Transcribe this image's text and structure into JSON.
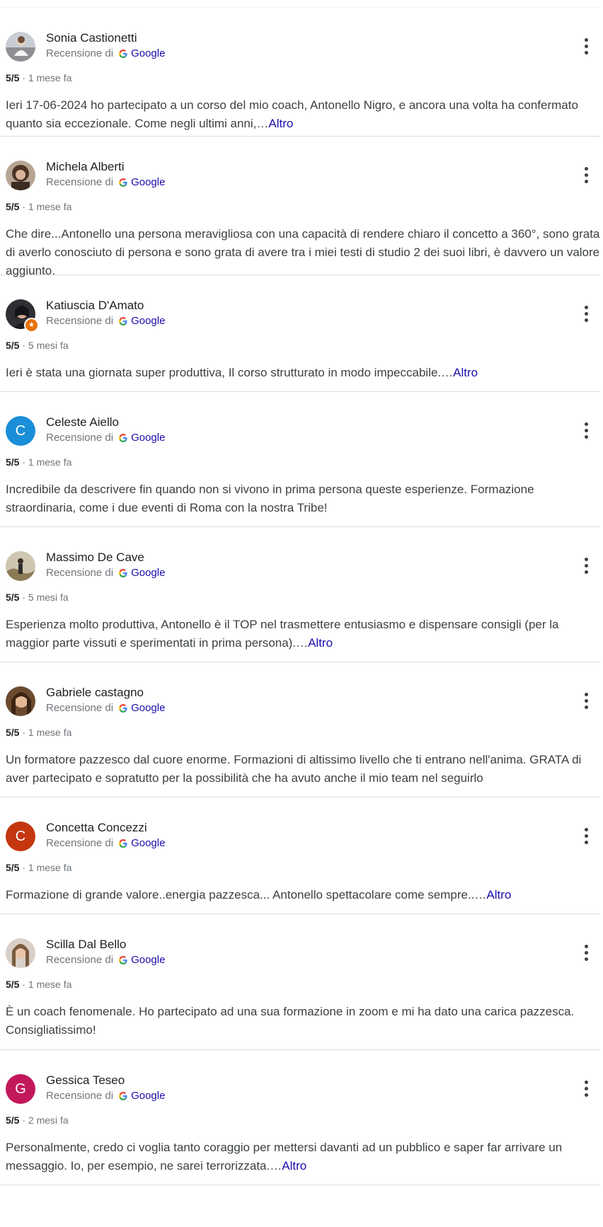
{
  "reviews": [
    {
      "name": "Sonia Castionetti",
      "source_prefix": "Recensione di",
      "source": "Google",
      "rating": "5/5",
      "time": "1 mese fa",
      "text": "Ieri 17-06-2024 ho partecipato a un corso del mio coach, Antonello Nigro, e ancora una volta ha confermato quanto sia eccezionale. Come negli ultimi anni,…",
      "more": "Altro"
    },
    {
      "name": "Michela Alberti",
      "source_prefix": "Recensione di",
      "source": "Google",
      "rating": "5/5",
      "time": "1 mese fa",
      "text": "Che dire...Antonello una persona meravigliosa con una capacità di rendere chiaro il concetto a 360°, sono grata di averlo conosciuto di persona e sono grata di avere tra i miei testi di studio 2 dei suoi libri, è davvero un valore aggiunto.",
      "more": ""
    },
    {
      "name": "Katiuscia D'Amato",
      "source_prefix": "Recensione di",
      "source": "Google",
      "rating": "5/5",
      "time": "5 mesi fa",
      "text": "Ieri è stata una giornata super produttiva, Il corso strutturato in modo impeccabile.…",
      "more": "Altro"
    },
    {
      "name": "Celeste Aiello",
      "source_prefix": "Recensione di",
      "source": "Google",
      "rating": "5/5",
      "time": "1 mese fa",
      "text": "Incredibile da descrivere fin quando non si vivono in prima persona queste esperienze. Formazione straordinaria, come i due eventi di Roma con la nostra Tribe!",
      "more": ""
    },
    {
      "name": "Massimo De Cave",
      "source_prefix": "Recensione di",
      "source": "Google",
      "rating": "5/5",
      "time": "5 mesi fa",
      "text": "Esperienza molto produttiva, Antonello è il TOP nel trasmettere entusiasmo e dispensare consigli (per la maggior parte vissuti e sperimentati in prima persona).…",
      "more": "Altro"
    },
    {
      "name": "Gabriele castagno",
      "source_prefix": "Recensione di",
      "source": "Google",
      "rating": "5/5",
      "time": "1 mese fa",
      "text": "Un formatore pazzesco dal cuore enorme. Formazioni di altissimo livello che ti entrano nell'anima. GRATA di aver partecipato e sopratutto per la possibilità che ha avuto anche il mio team nel seguirlo",
      "more": ""
    },
    {
      "name": "Concetta Concezzi",
      "source_prefix": "Recensione di",
      "source": "Google",
      "rating": "5/5",
      "time": "1 mese fa",
      "text": "Formazione di grande valore..energia pazzesca... Antonello spettacolare come sempre..…",
      "more": "Altro"
    },
    {
      "name": "Scilla Dal Bello",
      "source_prefix": "Recensione di",
      "source": "Google",
      "rating": "5/5",
      "time": "1 mese fa",
      "text": "È un coach fenomenale. Ho partecipato ad una sua formazione in zoom e mi ha dato una carica pazzesca. Consigliatissimo!",
      "more": ""
    },
    {
      "name": "Gessica Teseo",
      "source_prefix": "Recensione di",
      "source": "Google",
      "rating": "5/5",
      "time": "2 mesi fa",
      "text": "Personalmente, credo ci voglia tanto coraggio per mettersi davanti ad un pubblico e saper far arrivare un messaggio. Io, per esempio, ne sarei terrorizzata.…",
      "more": "Altro"
    }
  ],
  "letters": {
    "celeste": "C",
    "concetta": "C",
    "gessica": "G"
  },
  "colors": {
    "celeste": "#1a8ed8",
    "concetta": "#c4360f",
    "gessica": "#c2185b",
    "link": "#1a0dab",
    "badge": "#e8710a"
  },
  "icons": {
    "menu": "more-vert-icon",
    "google": "google-g-icon",
    "badge": "local-guide-star-icon"
  }
}
